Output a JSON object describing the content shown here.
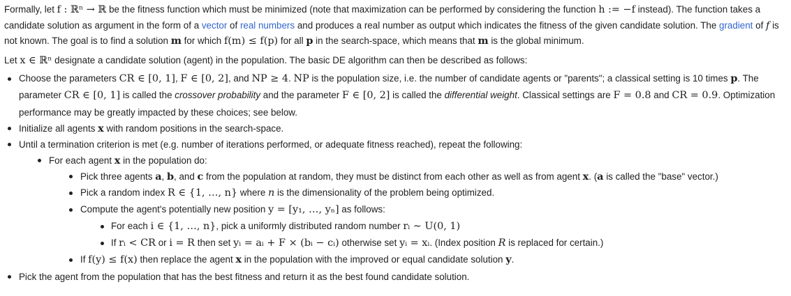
{
  "p1": {
    "t1": "Formally, let ",
    "m1": "f : ℝⁿ → ℝ",
    "t2": " be the fitness function which must be minimized (note that maximization can be performed by considering the function ",
    "m2": "h := −f",
    "t3": " instead). The function takes a candidate solution as argument in the form of a ",
    "link_vector": "vector",
    "t4": " of ",
    "link_real": "real numbers",
    "t5": " and produces a real number as output which indicates the fitness of the given candidate solution. The ",
    "link_gradient": "gradient",
    "t6": " of ",
    "m3": "f",
    "t7": " is not known. The goal is to find a solution ",
    "m4": "m",
    "t8": " for which ",
    "m5": "f(m) ≤ f(p)",
    "t9": " for all ",
    "m6": "p",
    "t10": " in the search-space, which means that ",
    "m7": "m",
    "t11": " is the global minimum."
  },
  "p2": {
    "t1": "Let ",
    "m1": "x ∈ ℝⁿ",
    "t2": " designate a candidate solution (agent) in the population. The basic DE algorithm can then be described as follows:"
  },
  "b1": {
    "t1": "Choose the parameters ",
    "m1": "CR ∈ [0, 1]",
    "t2": ", ",
    "m2": "F ∈ [0, 2]",
    "t3": ", and ",
    "m3": "NP ≥ 4",
    "t4": ". ",
    "m4": "NP",
    "t5": " is the population size, i.e. the number of candidate agents or \"parents\"; a classical setting is 10 times ",
    "m5": "p",
    "t6": ". The parameter ",
    "m6": "CR ∈ [0, 1]",
    "t7": " is called the ",
    "i1": "crossover probability",
    "t8": " and the parameter ",
    "m7": "F ∈ [0, 2]",
    "t9": " is called the ",
    "i2": "differential weight",
    "t10": ". Classical settings are ",
    "m8": "F = 0.8",
    "t11": " and ",
    "m9": "CR = 0.9",
    "t12": ". Optimization performance may be greatly impacted by these choices; see below."
  },
  "b2": {
    "t1": "Initialize all agents ",
    "m1": "x",
    "t2": " with random positions in the search-space."
  },
  "b3": {
    "t1": "Until a termination criterion is met (e.g. number of iterations performed, or adequate fitness reached), repeat the following:"
  },
  "b3a": {
    "t1": "For each agent ",
    "m1": "x",
    "t2": " in the population do:"
  },
  "c1": {
    "t1": "Pick three agents ",
    "m1": "a",
    "t2": ", ",
    "m2": "b",
    "t3": ", and ",
    "m3": "c",
    "t4": " from the population at random, they must be distinct from each other as well as from agent ",
    "m4": "x",
    "t5": ". (",
    "m5": "a",
    "t6": " is called the \"base\" vector.)"
  },
  "c2": {
    "t1": "Pick a random index ",
    "m1": "R ∈ {1, …, n}",
    "t2": " where ",
    "m2": "n",
    "t3": " is the dimensionality of the problem being optimized."
  },
  "c3": {
    "t1": "Compute the agent's potentially new position ",
    "m1": "y = [y₁, …, yₙ]",
    "t2": " as follows:"
  },
  "d1": {
    "t1": "For each ",
    "m1": "i ∈ {1, …, n}",
    "t2": ", pick a uniformly distributed random number ",
    "m2": "rᵢ ∼ U(0, 1)"
  },
  "d2": {
    "t1": "If ",
    "m1": "rᵢ < CR",
    "t2": " or ",
    "m2": "i = R",
    "t3": " then set ",
    "m3": "yᵢ = aᵢ + F × (bᵢ − cᵢ)",
    "t4": " otherwise set ",
    "m4": "yᵢ = xᵢ",
    "t5": ". (Index position ",
    "m5": "R",
    "t6": " is replaced for certain.)"
  },
  "c4": {
    "t1": "If ",
    "m1": "f(y) ≤ f(x)",
    "t2": " then replace the agent ",
    "m2": "x",
    "t3": " in the population with the improved or equal candidate solution ",
    "m3": "y",
    "t4": "."
  },
  "b4": {
    "t1": "Pick the agent from the population that has the best fitness and return it as the best found candidate solution."
  }
}
